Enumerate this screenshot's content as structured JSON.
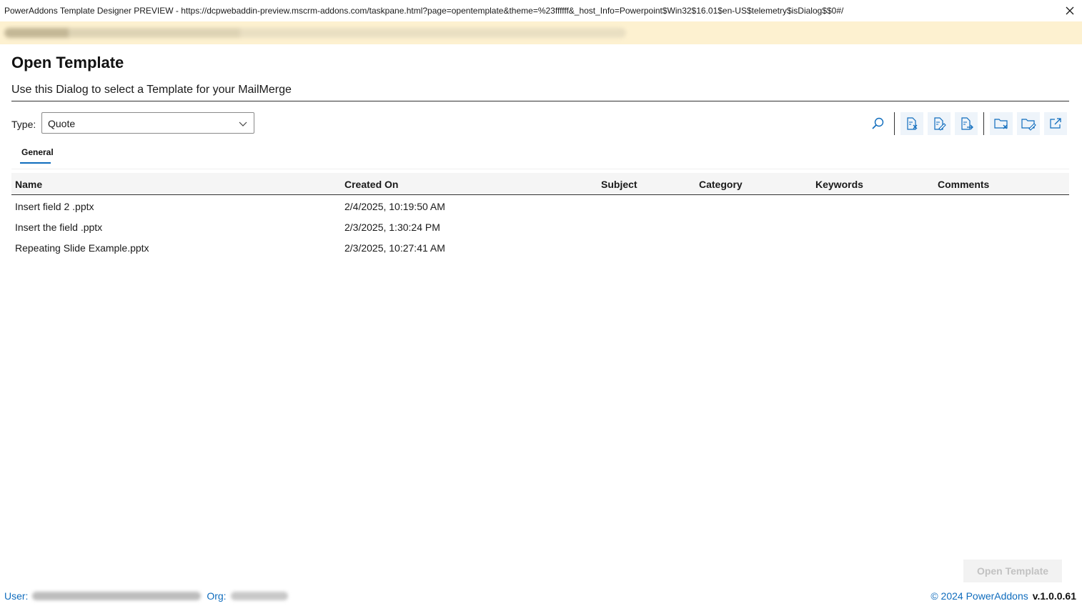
{
  "window": {
    "title": "PowerAddons Template Designer PREVIEW - https://dcpwebaddin-preview.mscrm-addons.com/taskpane.html?page=opentemplate&theme=%23ffffff&_host_Info=Powerpoint$Win32$16.01$en-US$telemetry$isDialog$$0#/",
    "close_icon": "close-icon"
  },
  "dialog": {
    "heading": "Open Template",
    "subheading": "Use this Dialog to select a Template for your MailMerge"
  },
  "type_selector": {
    "label": "Type:",
    "value": "Quote"
  },
  "toolbar": {
    "icons": [
      "search-icon",
      "delete-file-icon",
      "edit-file-icon",
      "move-file-icon",
      "delete-folder-icon",
      "edit-folder-icon",
      "open-external-icon"
    ],
    "accent": "#0f6cbd"
  },
  "tabs": [
    {
      "label": "General",
      "active": true
    }
  ],
  "table": {
    "columns": [
      "Name",
      "Created On",
      "Subject",
      "Category",
      "Keywords",
      "Comments"
    ],
    "rows": [
      {
        "name": "Insert field 2 .pptx",
        "created_on": "2/4/2025, 10:19:50 AM",
        "subject": "",
        "category": "",
        "keywords": "",
        "comments": ""
      },
      {
        "name": "Insert the field .pptx",
        "created_on": "2/3/2025, 1:30:24 PM",
        "subject": "",
        "category": "",
        "keywords": "",
        "comments": ""
      },
      {
        "name": "Repeating Slide Example.pptx",
        "created_on": "2/3/2025, 10:27:41 AM",
        "subject": "",
        "category": "",
        "keywords": "",
        "comments": ""
      }
    ]
  },
  "actions": {
    "open_label": "Open Template"
  },
  "footer": {
    "user_label": "User:",
    "org_label": "Org:",
    "copyright": "© 2024 PowerAddons",
    "version": "v.1.0.0.61"
  },
  "colors": {
    "banner": "#fdf1d0",
    "link": "#0f6cbd",
    "header_bg": "#f5f5f5"
  }
}
